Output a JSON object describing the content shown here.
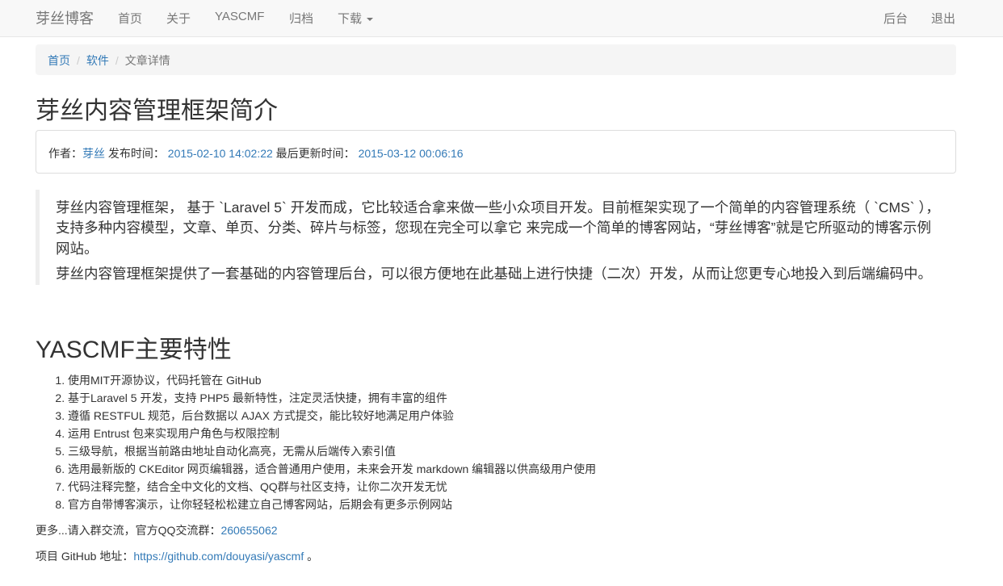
{
  "navbar": {
    "brand": "芽丝博客",
    "items": [
      "首页",
      "关于",
      "YASCMF",
      "归档",
      "下载"
    ],
    "right": [
      "后台",
      "退出"
    ]
  },
  "breadcrumb": [
    "首页",
    "软件",
    "文章详情"
  ],
  "article": {
    "title": "芽丝内容管理框架简介",
    "author_label": "作者：",
    "author": "芽丝",
    "published_label": "发布时间：",
    "published": "2015-02-10 14:02:22",
    "updated_label": "最后更新时间：",
    "updated": "2015-03-12 00:06:16",
    "intro_p1": "芽丝内容管理框架， 基于 `Laravel 5` 开发而成，它比较适合拿来做一些小众项目开发。目前框架实现了一个简单的内容管理系统（ `CMS` ），支持多种内容模型，文章、单页、分类、碎片与标签，您现在完全可以拿它 来完成一个简单的博客网站，“芽丝博客”就是它所驱动的博客示例网站。",
    "intro_p2": "芽丝内容管理框架提供了一套基础的内容管理后台，可以很方便地在此基础上进行快捷（二次）开发，从而让您更专心地投入到后端编码中。"
  },
  "features": {
    "title": "YASCMF主要特性",
    "items": [
      "使用MIT开源协议，代码托管在 GitHub",
      "基于Laravel 5 开发，支持 PHP5 最新特性，注定灵活快捷，拥有丰富的组件",
      "遵循 RESTFUL 规范，后台数据以 AJAX 方式提交，能比较好地满足用户体验",
      "运用 Entrust 包来实现用户角色与权限控制",
      "三级导航，根据当前路由地址自动化高亮，无需从后端传入索引值",
      "选用最新版的 CKEditor 网页编辑器，适合普通用户使用，未来会开发 markdown 编辑器以供高级用户使用",
      "代码注释完整，结合全中文化的文档、QQ群与社区支持，让你二次开发无忧",
      "官方自带博客演示，让你轻轻松松建立自己博客网站，后期会有更多示例网站"
    ]
  },
  "contact": {
    "text": "更多...请入群交流，官方QQ交流群：",
    "qq": "260655062"
  },
  "github": {
    "label": "项目 GitHub 地址：",
    "url": "https://github.com/douyasi/yascmf",
    "suffix": " 。"
  },
  "colors": {
    "link": "#337ab7",
    "navbar_bg": "#f8f8f8",
    "nav_text": "#777777"
  }
}
